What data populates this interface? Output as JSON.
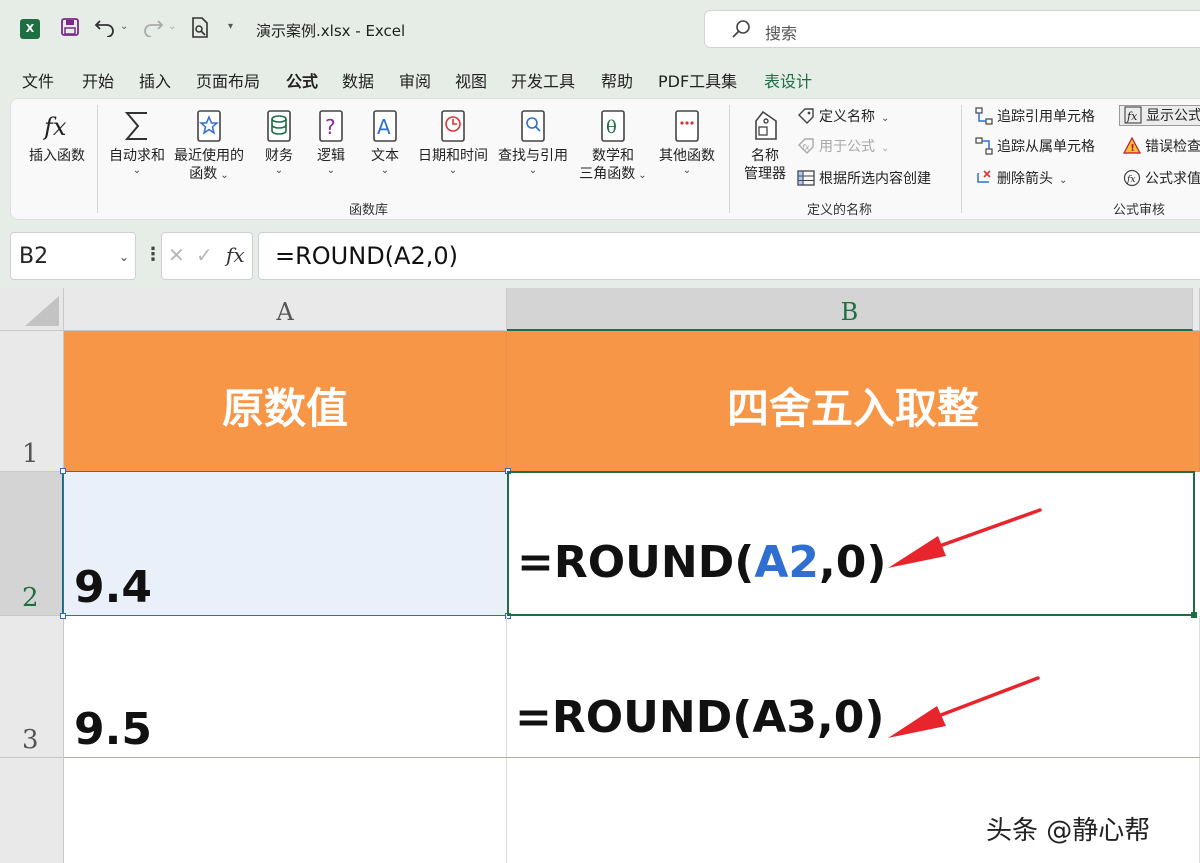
{
  "titlebar": {
    "app_logo": "X",
    "doc_title": "演示案例.xlsx - Excel",
    "search_placeholder": "搜索",
    "icons": [
      "excel-logo-icon",
      "save-icon",
      "undo-icon",
      "redo-icon",
      "print-preview-icon",
      "customize-qat-icon"
    ]
  },
  "tabs": [
    {
      "label": "文件"
    },
    {
      "label": "开始"
    },
    {
      "label": "插入"
    },
    {
      "label": "页面布局"
    },
    {
      "label": "公式",
      "active": true
    },
    {
      "label": "数据"
    },
    {
      "label": "审阅"
    },
    {
      "label": "视图"
    },
    {
      "label": "开发工具"
    },
    {
      "label": "帮助"
    },
    {
      "label": "PDF工具集"
    },
    {
      "label": "表设计",
      "contextual": true
    }
  ],
  "ribbon": {
    "function_library": {
      "group_label": "函数库",
      "insert_function": "插入函数",
      "autosum": "自动求和",
      "recent_line1": "最近使用的",
      "recent_line2": "函数",
      "financial": "财务",
      "logical": "逻辑",
      "text": "文本",
      "datetime": "日期和时间",
      "lookup": "查找与引用",
      "math_line1": "数学和",
      "math_line2": "三角函数",
      "more": "其他函数"
    },
    "defined_names": {
      "group_label": "定义的名称",
      "name_manager_line1": "名称",
      "name_manager_line2": "管理器",
      "define_name": "定义名称",
      "use_in_formula": "用于公式",
      "create_from_selection": "根据所选内容创建"
    },
    "formula_auditing": {
      "group_label": "公式审核",
      "trace_precedents": "追踪引用单元格",
      "trace_dependents": "追踪从属单元格",
      "remove_arrows": "删除箭头",
      "show_formulas": "显示公式",
      "error_checking": "错误检查",
      "evaluate_formula": "公式求值"
    }
  },
  "formula_bar": {
    "name_box": "B2",
    "formula": "=ROUND(A2,0)"
  },
  "sheet": {
    "columns": [
      "A",
      "B"
    ],
    "rows": [
      "1",
      "2",
      "3"
    ],
    "header_a": "原数值",
    "header_b": "四舍五入取整",
    "a2": "9.4",
    "a3": "9.5",
    "b2_prefix": "=ROUND(",
    "b2_ref": "A2",
    "b2_suffix": ",0)",
    "b3": "=ROUND(A3,0)",
    "selected_cell": "B2"
  },
  "watermark": "头条 @静心帮",
  "colors": {
    "excel_green": "#1d6f42",
    "header_fill": "#f79646",
    "arrow_red": "#e8242d",
    "ref_blue": "#2f6fd0"
  }
}
